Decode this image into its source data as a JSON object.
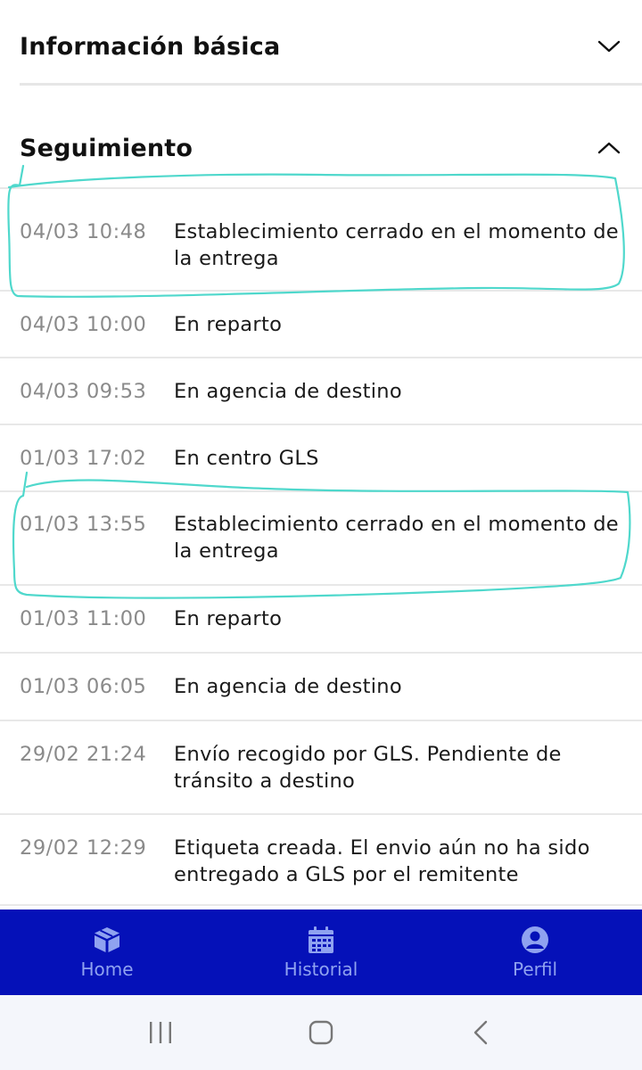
{
  "sections": {
    "basic_info": {
      "title": "Información básica",
      "expanded": false
    },
    "tracking": {
      "title": "Seguimiento",
      "expanded": true
    }
  },
  "events": [
    {
      "time": "04/03 10:48",
      "description": "Establecimiento cerrado en el momento de la entrega"
    },
    {
      "time": "04/03 10:00",
      "description": "En reparto"
    },
    {
      "time": "04/03 09:53",
      "description": "En agencia de destino"
    },
    {
      "time": "01/03 17:02",
      "description": "En centro GLS"
    },
    {
      "time": "01/03 13:55",
      "description": "Establecimiento cerrado en el momento de la entrega"
    },
    {
      "time": "01/03 11:00",
      "description": "En reparto"
    },
    {
      "time": "01/03 06:05",
      "description": "En agencia de destino"
    },
    {
      "time": "29/02 21:24",
      "description": "Envío recogido por GLS. Pendiente de tránsito a destino"
    },
    {
      "time": "29/02 12:29",
      "description": "Etiqueta creada. El envio aún no ha sido entregado a GLS por el remitente"
    }
  ],
  "bottom_nav": [
    {
      "label": "Home",
      "icon": "box-icon"
    },
    {
      "label": "Historial",
      "icon": "calendar-icon"
    },
    {
      "label": "Perfil",
      "icon": "user-icon"
    }
  ],
  "system_nav": {
    "recents_icon": "recents-icon",
    "home_icon": "home-circle-icon",
    "back_icon": "back-icon"
  },
  "colors": {
    "nav_background": "#0511b8",
    "nav_text": "#8fa2f0",
    "annotation_stroke": "#4fd8cc",
    "timestamp_text": "#8a8a8a"
  }
}
